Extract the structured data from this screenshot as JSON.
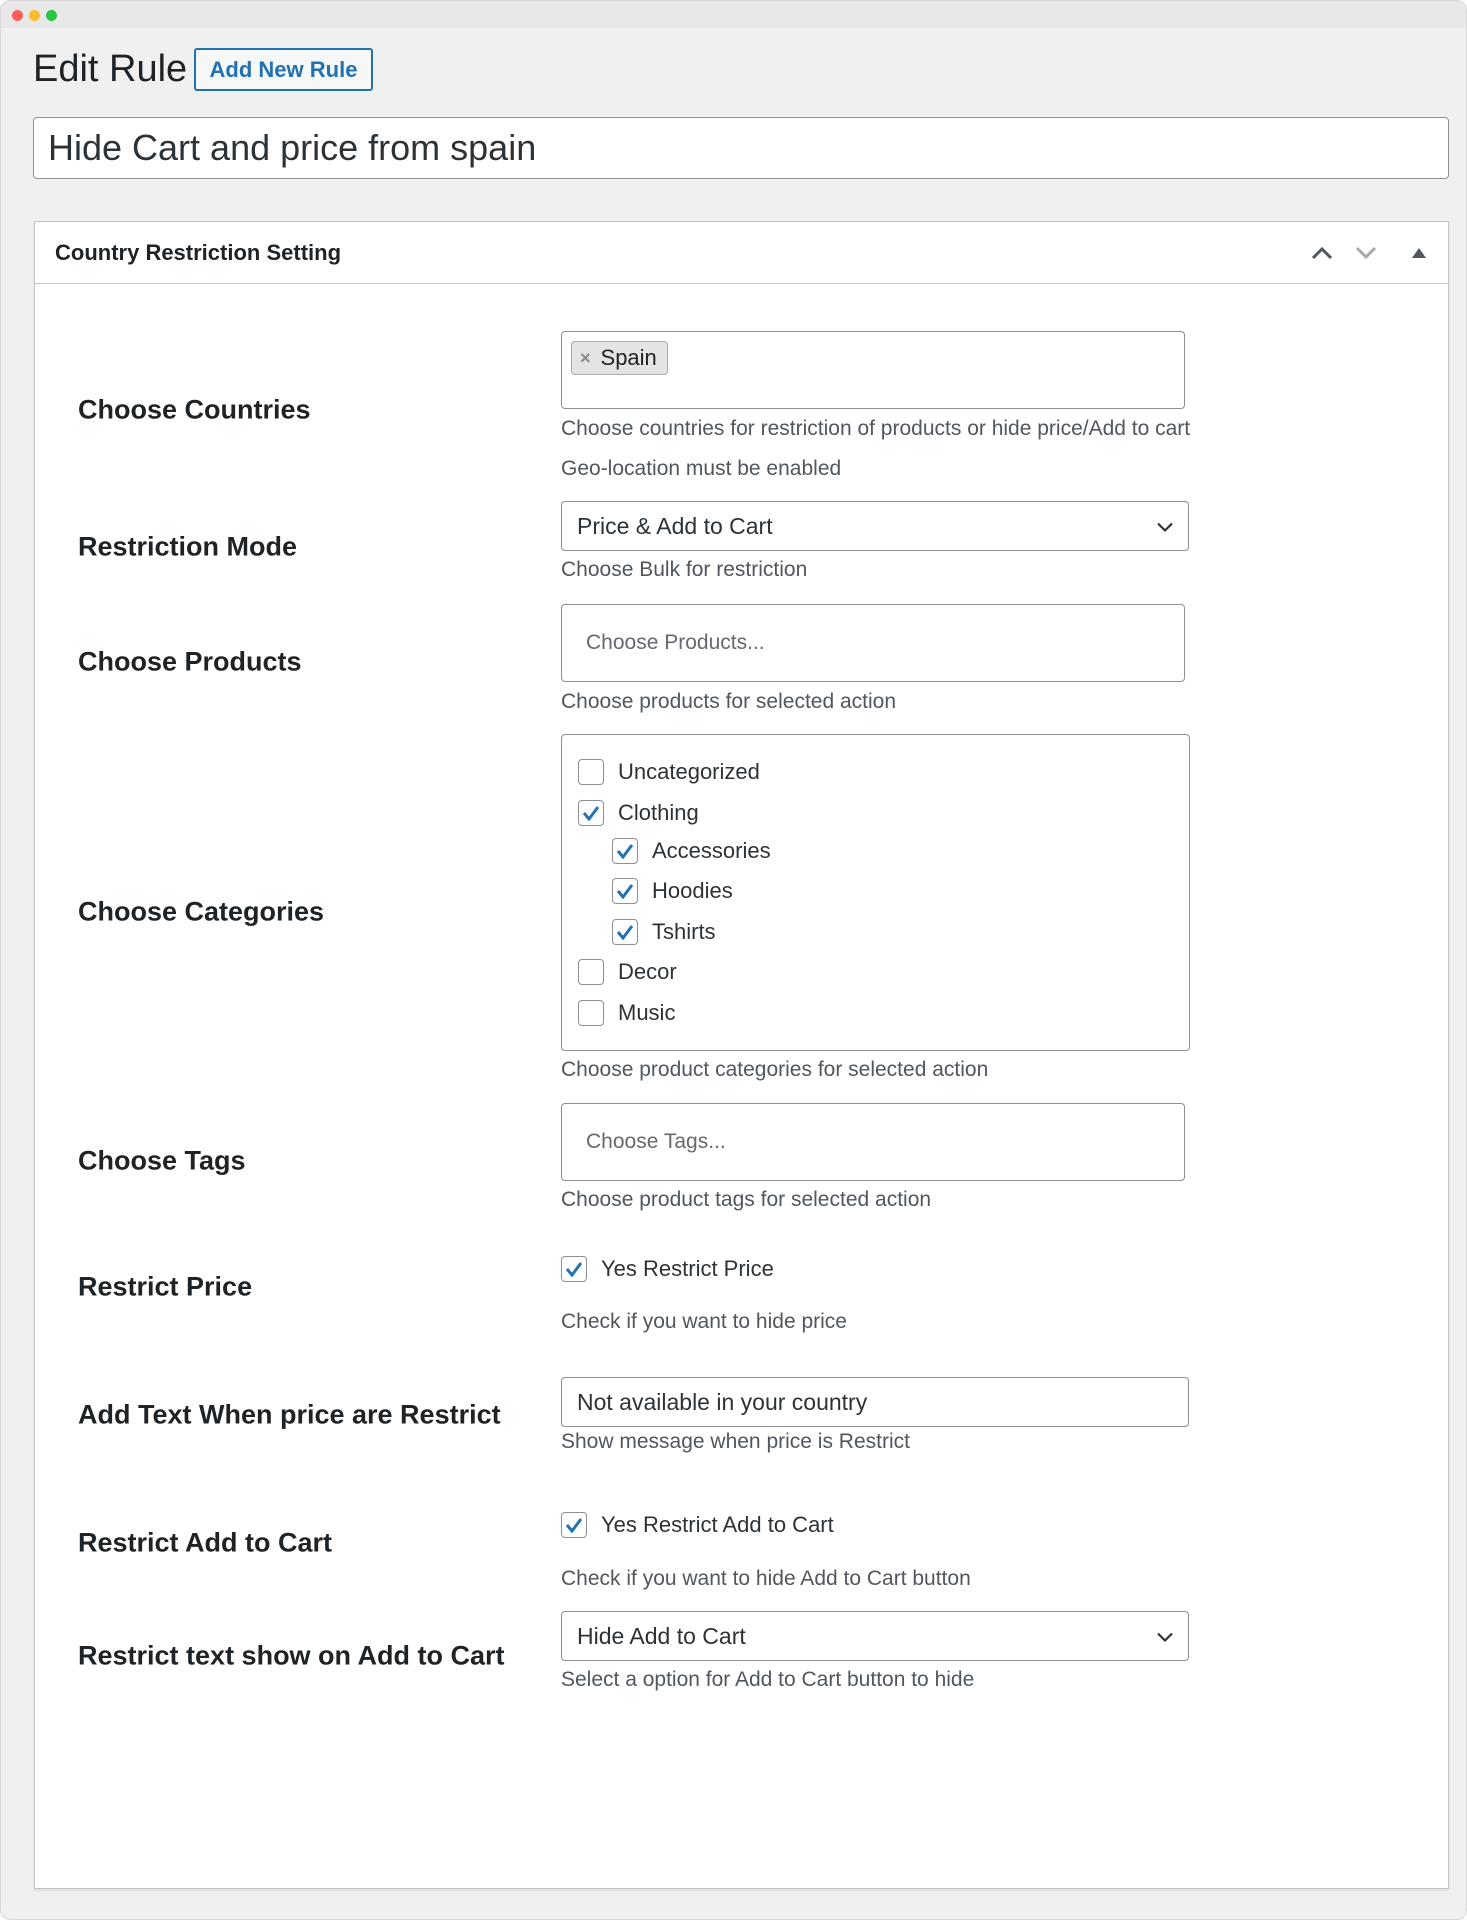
{
  "page": {
    "title": "Edit Rule",
    "add_new_label": "Add New Rule",
    "rule_title": "Hide Cart and price from spain"
  },
  "panel": {
    "title": "Country Restriction Setting",
    "icons": [
      "chevron-up-icon",
      "chevron-down-icon",
      "triangle-up-icon"
    ]
  },
  "fields": {
    "countries": {
      "label": "Choose Countries",
      "selected": [
        "Spain"
      ],
      "help": "Choose countries for restriction of products or hide price/Add to cart",
      "help2": "Geo-location must be enabled"
    },
    "mode": {
      "label": "Restriction Mode",
      "value": "Price & Add to Cart",
      "help": "Choose Bulk for restriction"
    },
    "products": {
      "label": "Choose Products",
      "placeholder": "Choose Products...",
      "help": "Choose products for selected action"
    },
    "categories": {
      "label": "Choose Categories",
      "items": [
        {
          "label": "Uncategorized",
          "checked": false,
          "level": 0
        },
        {
          "label": "Clothing",
          "checked": true,
          "level": 0
        },
        {
          "label": "Accessories",
          "checked": true,
          "level": 1
        },
        {
          "label": "Hoodies",
          "checked": true,
          "level": 1
        },
        {
          "label": "Tshirts",
          "checked": true,
          "level": 1
        },
        {
          "label": "Decor",
          "checked": false,
          "level": 0
        },
        {
          "label": "Music",
          "checked": false,
          "level": 0
        }
      ],
      "help": "Choose product categories for selected action"
    },
    "tags": {
      "label": "Choose Tags",
      "placeholder": "Choose Tags...",
      "help": "Choose product tags for selected action"
    },
    "restrict_price": {
      "label": "Restrict Price",
      "checkbox_label": "Yes Restrict Price",
      "checked": true,
      "help": "Check if you want to hide price"
    },
    "price_text": {
      "label": "Add Text When price are Restrict",
      "value": "Not available in your country",
      "help": "Show message when price is Restrict"
    },
    "restrict_cart": {
      "label": "Restrict Add to Cart",
      "checkbox_label": "Yes Restrict Add to Cart",
      "checked": true,
      "help": "Check if you want to hide Add to Cart button"
    },
    "cart_text": {
      "label": "Restrict text show on Add to Cart",
      "value": "Hide Add to Cart",
      "help": "Select a option for Add to Cart button to hide"
    }
  },
  "colors": {
    "accent": "#2271b1",
    "check": "#2271b1",
    "background": "#f0f0f1"
  }
}
